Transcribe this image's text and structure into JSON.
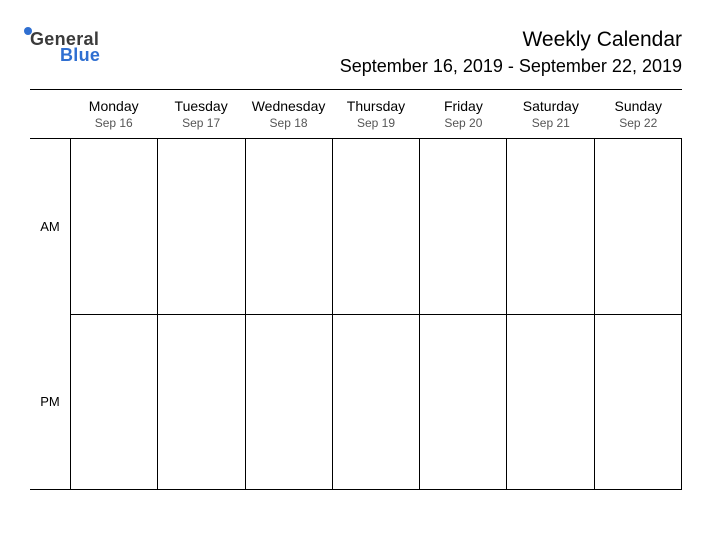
{
  "logo": {
    "line1": "General",
    "line2": "Blue"
  },
  "header": {
    "title": "Weekly Calendar",
    "date_range": "September 16, 2019 - September 22, 2019"
  },
  "days": [
    {
      "name": "Monday",
      "date": "Sep 16"
    },
    {
      "name": "Tuesday",
      "date": "Sep 17"
    },
    {
      "name": "Wednesday",
      "date": "Sep 18"
    },
    {
      "name": "Thursday",
      "date": "Sep 19"
    },
    {
      "name": "Friday",
      "date": "Sep 20"
    },
    {
      "name": "Saturday",
      "date": "Sep 21"
    },
    {
      "name": "Sunday",
      "date": "Sep 22"
    }
  ],
  "periods": {
    "am": "AM",
    "pm": "PM"
  }
}
